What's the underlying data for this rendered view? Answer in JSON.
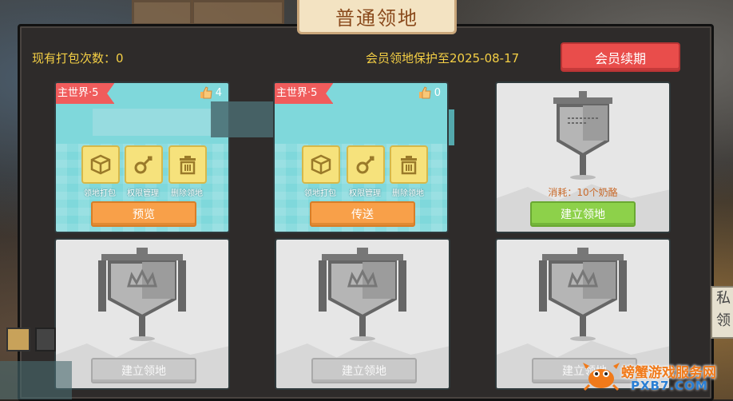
{
  "title": "普通领地",
  "header": {
    "pack_count_label": "现有打包次数：0",
    "protection_label": "会员领地保护至2025-08-17",
    "vip_renew_button": "会员续期"
  },
  "cards": [
    {
      "type": "owned",
      "world_label": "主世界·5",
      "likes": "4",
      "actions": [
        {
          "label": "领地打包",
          "icon": "box-icon"
        },
        {
          "label": "权限管理",
          "icon": "key-icon"
        },
        {
          "label": "删除领地",
          "icon": "trash-icon"
        }
      ],
      "button": "预览"
    },
    {
      "type": "owned",
      "world_label": "主世界·5",
      "likes": "0",
      "actions": [
        {
          "label": "领地打包",
          "icon": "box-icon"
        },
        {
          "label": "权限管理",
          "icon": "key-icon"
        },
        {
          "label": "删除领地",
          "icon": "trash-icon"
        }
      ],
      "button": "传送"
    },
    {
      "type": "available",
      "cost": "消耗：10个奶酪",
      "button": "建立领地"
    },
    {
      "type": "locked",
      "button": "建立领地"
    },
    {
      "type": "locked",
      "button": "建立领地"
    },
    {
      "type": "locked",
      "button": "建立领地"
    }
  ],
  "side_tab": {
    "line1": "私",
    "line2": "领"
  },
  "watermark": {
    "text": "螃蟹游戏服务网",
    "url": "PXB7.COM"
  },
  "colors": {
    "accent_red": "#e94d4b",
    "accent_orange": "#f8a049",
    "accent_green": "#8dd14a",
    "title_text": "#8a4a1c",
    "info_yellow": "#f4cf45",
    "card_teal": "#7fd8db"
  }
}
